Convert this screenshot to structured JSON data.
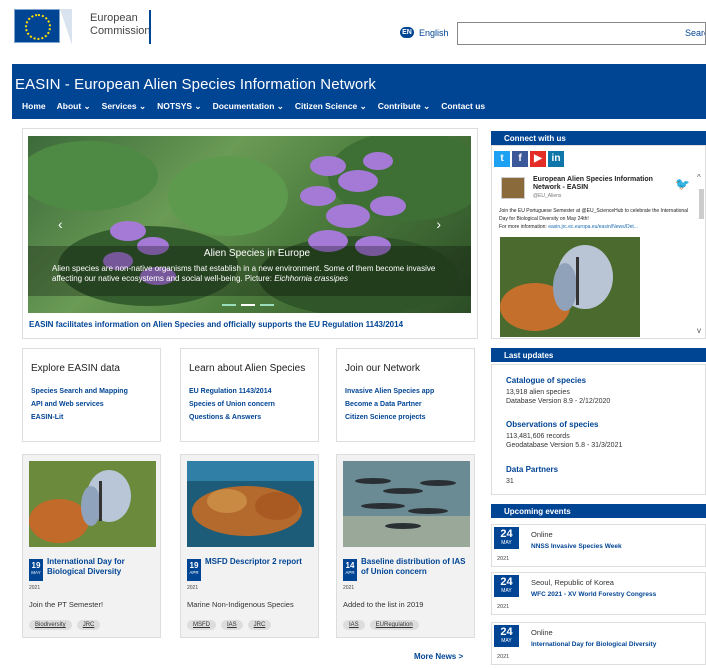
{
  "brand": {
    "commission_line1": "European",
    "commission_line2": "Commission",
    "language": "English",
    "language_icon": "globe-icon",
    "search_label": "Search"
  },
  "header": {
    "title": "EASIN - European Alien Species Information Network",
    "nav": [
      "Home",
      "About ⌄",
      "Services ⌄",
      "NOTSYS ⌄",
      "Documentation ⌄",
      "Citizen Science ⌄",
      "Contribute ⌄",
      "Contact us"
    ]
  },
  "hero": {
    "title": "Alien Species in Europe",
    "text": "Alien species are non-native organisms that establish in a new environment. Some of them become invasive affecting our native ecosystems and social well-being. Picture: ",
    "text_italic": "Eichhornia crassipes",
    "link": "EASIN facilitates information on Alien Species and officially supports the EU Regulation 1143/2014"
  },
  "columns": [
    {
      "title": "Explore EASIN data",
      "links": [
        "Species Search and Mapping",
        "API and Web services",
        "EASIN-Lit"
      ]
    },
    {
      "title": "Learn about Alien Species",
      "links": [
        "EU Regulation 1143/2014",
        "Species of Union concern",
        "Questions & Answers"
      ]
    },
    {
      "title": "Join our Network",
      "links": [
        "Invasive Alien Species app",
        "Become a Data Partner",
        "Citizen Science projects"
      ]
    }
  ],
  "news": [
    {
      "day": "19",
      "month": "MAY",
      "year": "2021",
      "title": "International Day for Biological Diversity",
      "desc": "Join the PT Semester!",
      "tags": [
        "Biodiversity",
        "JRC"
      ]
    },
    {
      "day": "19",
      "month": "APR",
      "year": "2021",
      "title": "MSFD Descriptor 2 report",
      "desc": "Marine Non-Indigenous Species",
      "tags": [
        "MSFD",
        "IAS",
        "JRC"
      ]
    },
    {
      "day": "14",
      "month": "APR",
      "year": "2021",
      "title": "Baseline distribution of IAS of Union concern",
      "desc": "Added to the list in 2019",
      "tags": [
        "IAS",
        "EURegulation"
      ]
    }
  ],
  "more_news": "More News  >",
  "sidebar": {
    "connect_title": "Connect with us",
    "social": [
      "twitter-icon",
      "facebook-icon",
      "youtube-icon",
      "linkedin-icon"
    ],
    "tweet": {
      "name": "European Alien Species Information Network - EASIN",
      "handle": "@EU_Aliens",
      "text": "Join the EU Portuguese Semester at @EU_ScienceHub to celebrate the International Day for Biological Diversity on May 24th!",
      "more": "For more information: ",
      "link": "easin.jrc.ec.europa.eu/easin/News/Det..."
    },
    "updates_title": "Last updates",
    "updates": [
      {
        "title": "Catalogue of species",
        "line1": "13,918 alien species",
        "line2": "Database Version 8.9 - 2/12/2020"
      },
      {
        "title": "Observations of species",
        "line1": "113,481,606 records",
        "line2": "Geodatabase Version 5.8 - 31/3/2021"
      },
      {
        "title": "Data Partners",
        "line1": "31",
        "line2": ""
      }
    ],
    "events_title": "Upcoming events",
    "events": [
      {
        "day": "24",
        "month": "MAY",
        "year": "2021",
        "location": "Online",
        "title": "NNSS Invasive Species Week"
      },
      {
        "day": "24",
        "month": "MAY",
        "year": "2021",
        "location": "Seoul, Republic of Korea",
        "title": "WFC 2021 - XV World Forestry Congress"
      },
      {
        "day": "24",
        "month": "MAY",
        "year": "2021",
        "location": "Online",
        "title": "International Day for Biological Diversity"
      }
    ]
  }
}
